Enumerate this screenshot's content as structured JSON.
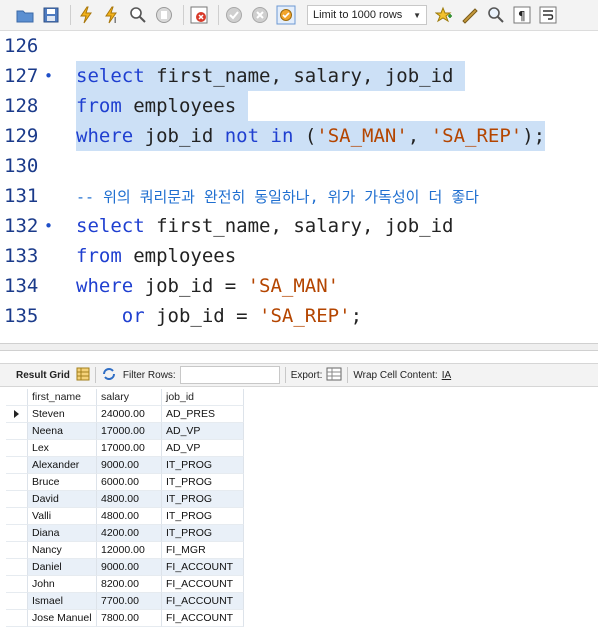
{
  "toolbar": {
    "limit_label": "Limit to 1000 rows",
    "buttons": [
      "open-folder-icon",
      "save-icon",
      "execute-icon",
      "execute-current-icon",
      "explain-icon",
      "stop-icon",
      "toggle-error-icon",
      "commit-icon",
      "rollback-icon",
      "autocommit-icon",
      "add-snippet-icon",
      "beautify-icon",
      "find-icon",
      "invisible-chars-icon",
      "wrap-icon"
    ]
  },
  "editor": {
    "lines": [
      {
        "num": "126",
        "dot": "",
        "tokens": []
      },
      {
        "num": "127",
        "dot": "•",
        "hl": true,
        "tokens": [
          [
            "kw",
            "select"
          ],
          [
            "t",
            " first_name, salary, job_id "
          ]
        ]
      },
      {
        "num": "128",
        "dot": "",
        "hl": true,
        "tokens": [
          [
            "kw",
            "from"
          ],
          [
            "t",
            " employees "
          ]
        ]
      },
      {
        "num": "129",
        "dot": "",
        "hl": true,
        "tokens": [
          [
            "kw",
            "where"
          ],
          [
            "t",
            " job_id "
          ],
          [
            "kw",
            "not"
          ],
          [
            "t",
            " "
          ],
          [
            "kw",
            "in"
          ],
          [
            "t",
            " ("
          ],
          [
            "str",
            "'SA_MAN'"
          ],
          [
            "t",
            ", "
          ],
          [
            "str",
            "'SA_REP'"
          ],
          [
            "t",
            ");"
          ]
        ]
      },
      {
        "num": "130",
        "dot": "",
        "tokens": []
      },
      {
        "num": "131",
        "dot": "",
        "tokens": [
          [
            "cm",
            "-- 위의 쿼리문과 완전히 동일하나, 위가 가독성이 더 좋다"
          ]
        ]
      },
      {
        "num": "132",
        "dot": "•",
        "tokens": [
          [
            "kw",
            "select"
          ],
          [
            "t",
            " first_name, salary, job_id"
          ]
        ]
      },
      {
        "num": "133",
        "dot": "",
        "tokens": [
          [
            "kw",
            "from"
          ],
          [
            "t",
            " employees"
          ]
        ]
      },
      {
        "num": "134",
        "dot": "",
        "tokens": [
          [
            "kw",
            "where"
          ],
          [
            "t",
            " job_id = "
          ],
          [
            "str",
            "'SA_MAN'"
          ]
        ]
      },
      {
        "num": "135",
        "dot": "",
        "tokens": [
          [
            "t",
            "    "
          ],
          [
            "kw",
            "or"
          ],
          [
            "t",
            " job_id = "
          ],
          [
            "str",
            "'SA_REP'"
          ],
          [
            "t",
            ";"
          ]
        ]
      }
    ]
  },
  "result_bar": {
    "result_grid": "Result Grid",
    "filter_rows": "Filter Rows:",
    "export": "Export:",
    "wrap": "Wrap Cell Content:"
  },
  "grid": {
    "columns": [
      "first_name",
      "salary",
      "job_id"
    ],
    "rows": [
      [
        "Steven",
        "24000.00",
        "AD_PRES"
      ],
      [
        "Neena",
        "17000.00",
        "AD_VP"
      ],
      [
        "Lex",
        "17000.00",
        "AD_VP"
      ],
      [
        "Alexander",
        "9000.00",
        "IT_PROG"
      ],
      [
        "Bruce",
        "6000.00",
        "IT_PROG"
      ],
      [
        "David",
        "4800.00",
        "IT_PROG"
      ],
      [
        "Valli",
        "4800.00",
        "IT_PROG"
      ],
      [
        "Diana",
        "4200.00",
        "IT_PROG"
      ],
      [
        "Nancy",
        "12000.00",
        "FI_MGR"
      ],
      [
        "Daniel",
        "9000.00",
        "FI_ACCOUNT"
      ],
      [
        "John",
        "8200.00",
        "FI_ACCOUNT"
      ],
      [
        "Ismael",
        "7700.00",
        "FI_ACCOUNT"
      ],
      [
        "Jose Manuel",
        "7800.00",
        "FI_ACCOUNT"
      ]
    ]
  },
  "colors": {
    "keyword": "#1f3fd0",
    "string": "#b44500",
    "comment": "#1f6fd0",
    "selection": "#cce0f6"
  }
}
